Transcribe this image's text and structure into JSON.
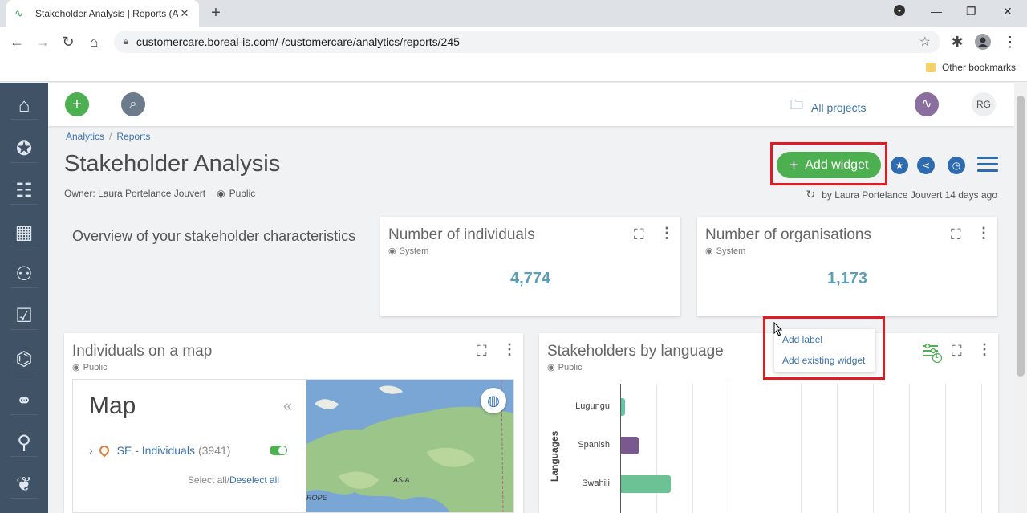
{
  "browser": {
    "tab_title": "Stakeholder Analysis | Reports (A",
    "tab_close": "✕",
    "new_tab": "+",
    "url": "customercare.boreal-is.com/-/customercare/analytics/reports/245",
    "bookmarks_other": "Other bookmarks"
  },
  "topbar": {
    "all_projects": "All projects",
    "user_initials": "RG"
  },
  "breadcrumb": {
    "items": [
      "Analytics",
      "Reports"
    ],
    "separator": "/"
  },
  "page": {
    "title": "Stakeholder Analysis",
    "owner": "Owner: Laura Portelance Jouvert",
    "visibility": "Public",
    "modified": "by Laura Portelance Jouvert 14 days ago",
    "add_widget": "Add widget",
    "overview_text": "Overview of your stakeholder characteristics"
  },
  "cards": {
    "individuals": {
      "title": "Number of individuals",
      "sub": "System",
      "value": "4,774"
    },
    "organisations": {
      "title": "Number of organisations",
      "sub": "System",
      "value": "1,173"
    }
  },
  "context_menu": {
    "add_label": "Add label",
    "add_existing": "Add existing widget"
  },
  "map_widget": {
    "title": "Individuals on a map",
    "sub": "Public",
    "panel_title": "Map",
    "layer_name": "SE - Individuals",
    "layer_count": "(3941)",
    "select_all": "Select all",
    "separator": "/",
    "deselect_all": "Deselect all",
    "labels": {
      "asia": "ASIA",
      "europe": "ROPE"
    }
  },
  "lang_widget": {
    "title": "Stakeholders by language",
    "sub": "Public",
    "filter_badge": "1",
    "y_axis_label": "Languages"
  },
  "chart_data": {
    "type": "bar",
    "orientation": "horizontal",
    "categories": [
      "Lugungu",
      "Spanish",
      "Swahili"
    ],
    "values": [
      1,
      4,
      11
    ],
    "colors": [
      "#5fc3a4",
      "#7a5a8e",
      "#6cc294"
    ],
    "ylabel": "Languages",
    "xlim": [
      0,
      80
    ]
  },
  "icons": {
    "sidebar": [
      "home-icon",
      "star-icon",
      "stakeholders-icon",
      "organisations-icon",
      "groups-icon",
      "tasks-icon",
      "communities-icon",
      "engagement-icon",
      "map-pin-icon",
      "leaf-icon"
    ]
  }
}
